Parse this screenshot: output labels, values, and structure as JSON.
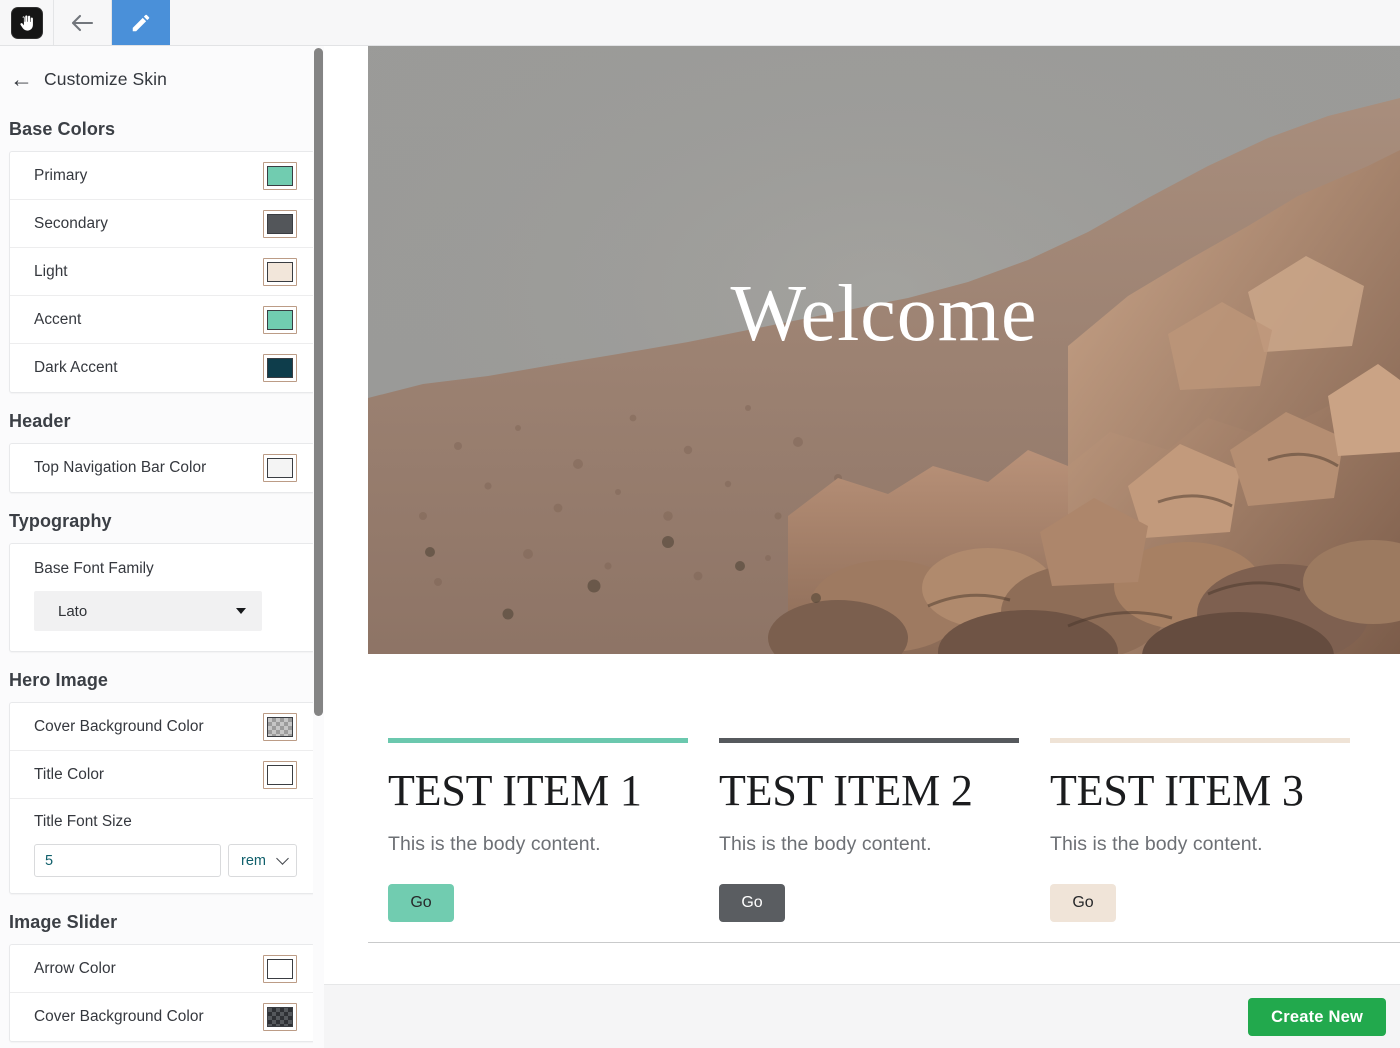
{
  "toolbar": {
    "app_icon": "hand-logo-icon",
    "back_icon": "back-arrow-icon",
    "edit_icon": "pencil-icon",
    "edit_tab_color": "#4a90d9"
  },
  "sidebar": {
    "back_label": "Customize Skin",
    "back_icon": "left-arrow-icon",
    "sections": [
      {
        "title": "Base Colors",
        "rows": [
          {
            "label": "Primary",
            "swatch": "#71ccb0",
            "kind": "solid"
          },
          {
            "label": "Secondary",
            "swatch": "#53565a",
            "kind": "solid"
          },
          {
            "label": "Light",
            "swatch": "#f2e6da",
            "kind": "solid"
          },
          {
            "label": "Accent",
            "swatch": "#71ccb0",
            "kind": "solid"
          },
          {
            "label": "Dark Accent",
            "swatch": "#0e3d4b",
            "kind": "solid"
          }
        ]
      },
      {
        "title": "Header",
        "rows": [
          {
            "label": "Top Navigation Bar Color",
            "swatch": "#f4f4f4",
            "kind": "solid"
          }
        ]
      },
      {
        "title": "Typography",
        "font_family_label": "Base Font Family",
        "font_family_value": "Lato"
      },
      {
        "title": "Hero Image",
        "rows": [
          {
            "label": "Cover Background Color",
            "swatch": "",
            "kind": "checker"
          },
          {
            "label": "Title Color",
            "swatch": "#ffffff",
            "kind": "solid"
          }
        ],
        "font_size_label": "Title Font Size",
        "font_size_value": "5",
        "font_size_unit": "rem",
        "font_size_placeholder": "5"
      },
      {
        "title": "Image Slider",
        "rows": [
          {
            "label": "Arrow Color",
            "swatch": "#ffffff",
            "kind": "solid"
          },
          {
            "label": "Cover Background Color",
            "swatch": "",
            "kind": "checker-dark"
          }
        ]
      }
    ]
  },
  "preview": {
    "hero_title": "Welcome",
    "cards": [
      {
        "bar_color": "#6bc8ae",
        "title": "TEST ITEM 1",
        "body": "This is the body content.",
        "button_label": "Go",
        "button_bg": "#71ccb0",
        "button_fg": "#27282a"
      },
      {
        "bar_color": "#56595d",
        "title": "TEST ITEM 2",
        "body": "This is the body content.",
        "button_label": "Go",
        "button_bg": "#5a5d61",
        "button_fg": "#ffffff"
      },
      {
        "bar_color": "#efe3d6",
        "title": "TEST ITEM 3",
        "body": "This is the body content.",
        "button_label": "Go",
        "button_bg": "#f0e4d8",
        "button_fg": "#27282a"
      }
    ]
  },
  "footer": {
    "create_new_label": "Create New",
    "create_new_color": "#22a94d"
  }
}
